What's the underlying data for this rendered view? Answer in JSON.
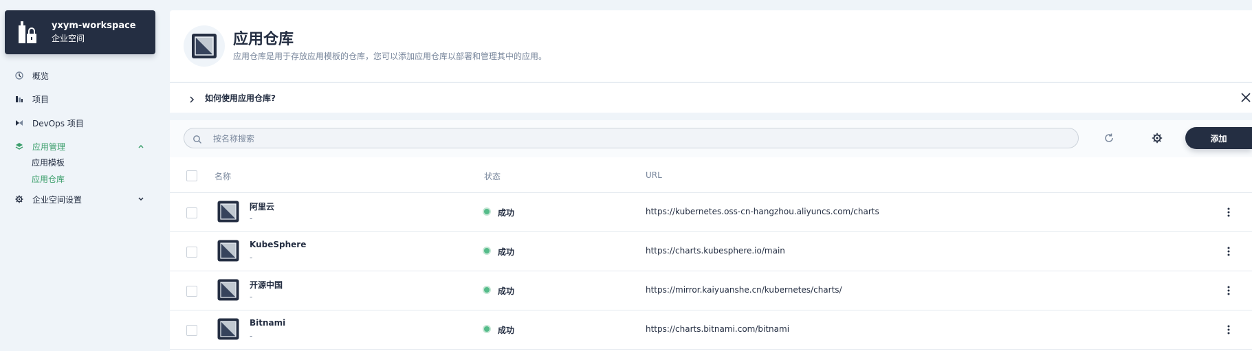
{
  "workspace": {
    "name": "yxym-workspace",
    "type": "企业空间"
  },
  "nav": {
    "overview": "概览",
    "projects": "项目",
    "devops": "DevOps 项目",
    "app_mgmt": "应用管理",
    "app_templates": "应用模板",
    "app_repos": "应用仓库",
    "ws_settings": "企业空间设置"
  },
  "banner": {
    "title": "应用仓库",
    "description": "应用仓库是用于存放应用模板的仓库，您可以添加应用仓库以部署和管理其中的应用。"
  },
  "howto": {
    "label": "如何使用应用仓库?"
  },
  "toolbar": {
    "search_placeholder": "按名称搜索",
    "add_label": "添加"
  },
  "table": {
    "columns": {
      "name": "名称",
      "status": "状态",
      "url": "URL"
    },
    "rows": [
      {
        "name": "阿里云",
        "desc": "-",
        "status": "成功",
        "url": "https://kubernetes.oss-cn-hangzhou.aliyuncs.com/charts"
      },
      {
        "name": "KubeSphere",
        "desc": "-",
        "status": "成功",
        "url": "https://charts.kubesphere.io/main"
      },
      {
        "name": "开源中国",
        "desc": "-",
        "status": "成功",
        "url": "https://mirror.kaiyuanshe.cn/kubernetes/charts/"
      },
      {
        "name": "Bitnami",
        "desc": "-",
        "status": "成功",
        "url": "https://charts.bitnami.com/bitnami"
      }
    ]
  },
  "colors": {
    "dark": "#242e42",
    "accent_green": "#3b9e6b",
    "success": "#55bc8a",
    "muted": "#79879c",
    "background": "#eff4f9"
  }
}
